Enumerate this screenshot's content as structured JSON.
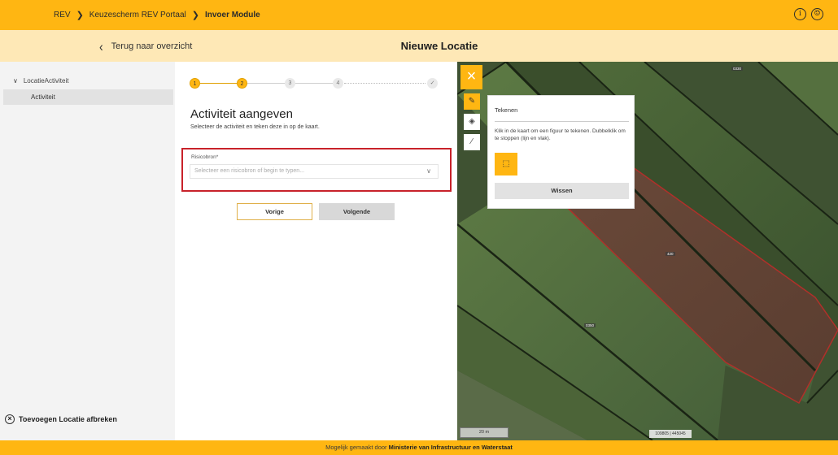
{
  "breadcrumb": {
    "items": [
      "REV",
      "Keuzescherm REV Portaal",
      "Invoer Module"
    ]
  },
  "topbar": {
    "info_icon": "info-icon",
    "user_icon": "user-icon"
  },
  "subheader": {
    "back_label": "Terug naar overzicht",
    "title": "Nieuwe Locatie"
  },
  "sidebar": {
    "parent_label": "LocatieActiviteit",
    "child_label": "Activiteit",
    "abort_label": "Toevoegen Locatie afbreken"
  },
  "stepper": {
    "steps": [
      "1",
      "2",
      "3",
      "4",
      "✓"
    ],
    "current": 2
  },
  "form": {
    "title": "Activiteit aangeven",
    "subtitle": "Selecteer de activiteit en teken deze in op de kaart.",
    "field_label": "Risicobron*",
    "select_placeholder": "Selecteer een risicobron of begin te typen...",
    "prev_label": "Vorige",
    "next_label": "Volgende"
  },
  "map": {
    "panel_title": "Tekenen",
    "panel_help": "Klik in de kaart om een figuur te tekenen. Dubbelklik om te stoppen (lijn en vlak).",
    "clear_label": "Wissen",
    "scale_label": "20 m",
    "coords": "109805 | 445045",
    "labels": [
      "0330",
      "420",
      "0350"
    ]
  },
  "footer": {
    "prefix": "Mogelijk gemaakt door",
    "org": "Ministerie van Infrastructuur en Waterstaat"
  },
  "colors": {
    "accent": "#ffb612",
    "highlight": "#c8222a",
    "subbar": "#fee8b6",
    "sidebar": "#f3f3f3"
  }
}
